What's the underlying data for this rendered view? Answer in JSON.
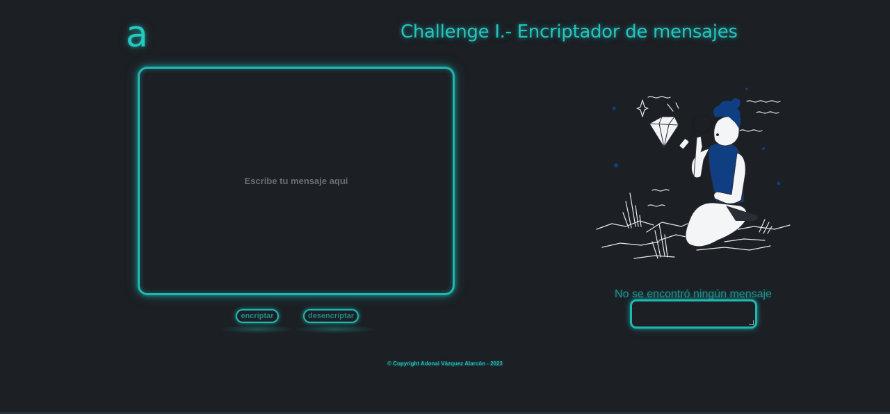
{
  "header": {
    "logo_text": "a",
    "title": "Challenge I.- Encriptador de mensajes"
  },
  "input": {
    "placeholder": "Escribe tu mensaje aqui",
    "value": ""
  },
  "buttons": {
    "encrypt_label": "encriptar",
    "decrypt_label": "desencriptar"
  },
  "output": {
    "empty_message": "No se encontró ningún mensaje",
    "value": ""
  },
  "illustration": {
    "icon": "person-inspecting-diamond-illustration"
  },
  "footer": {
    "copyright": "© Copyright Adonai Vázquez Alarcón - 2023"
  },
  "colors": {
    "background": "#1c1f24",
    "accent": "#1fb7b1",
    "title": "#26c4be",
    "illustration_blue": "#0f3e82"
  }
}
